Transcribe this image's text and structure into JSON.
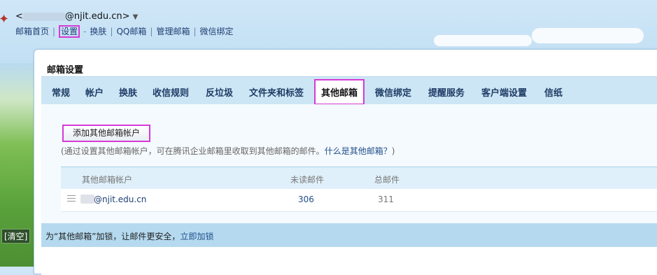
{
  "header": {
    "user_prefix": "<",
    "user_email": "@njit.edu.cn>",
    "user_dropdown": "▼",
    "nav": [
      {
        "label": "邮箱首页"
      },
      {
        "label": "设置"
      },
      {
        "label": "换肤"
      },
      {
        "label": "QQ邮箱"
      },
      {
        "label": "管理邮箱"
      },
      {
        "label": "微信绑定"
      }
    ],
    "sep_after_settings": "-"
  },
  "sidebar": {
    "clear_label": "[清空]"
  },
  "panel": {
    "title": "邮箱设置",
    "tabs": [
      {
        "label": "常规"
      },
      {
        "label": "帐户"
      },
      {
        "label": "换肤"
      },
      {
        "label": "收信规则"
      },
      {
        "label": "反垃圾"
      },
      {
        "label": "文件夹和标签"
      },
      {
        "label": "其他邮箱",
        "active": true
      },
      {
        "label": "微信绑定"
      },
      {
        "label": "提醒服务"
      },
      {
        "label": "客户端设置"
      },
      {
        "label": "信纸"
      }
    ],
    "add_button": "添加其他邮箱帐户",
    "desc_text": "(通过设置其他邮箱帐户，可在腾讯企业邮箱里收取到其他邮箱的邮件。",
    "desc_link": "什么是其他邮箱？",
    "desc_end": ")",
    "table": {
      "headers": [
        "其他邮箱帐户",
        "未读邮件",
        "总邮件"
      ],
      "rows": [
        {
          "account": "@njit.edu.cn",
          "unread": "306",
          "total": "311"
        }
      ]
    },
    "bottom_text": "为“其他邮箱”加锁，让邮件更安全，",
    "bottom_link": "立即加锁"
  }
}
